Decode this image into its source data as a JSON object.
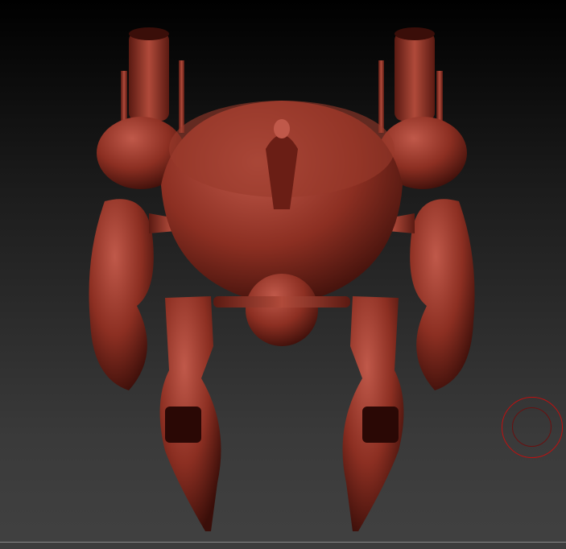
{
  "viewport": {
    "background_top": "#000000",
    "background_bottom": "#414141",
    "model_color": "#8c2f22",
    "model_highlight": "#c0594a",
    "model_shadow": "#3a0e09",
    "brush_color": "#c01010"
  }
}
